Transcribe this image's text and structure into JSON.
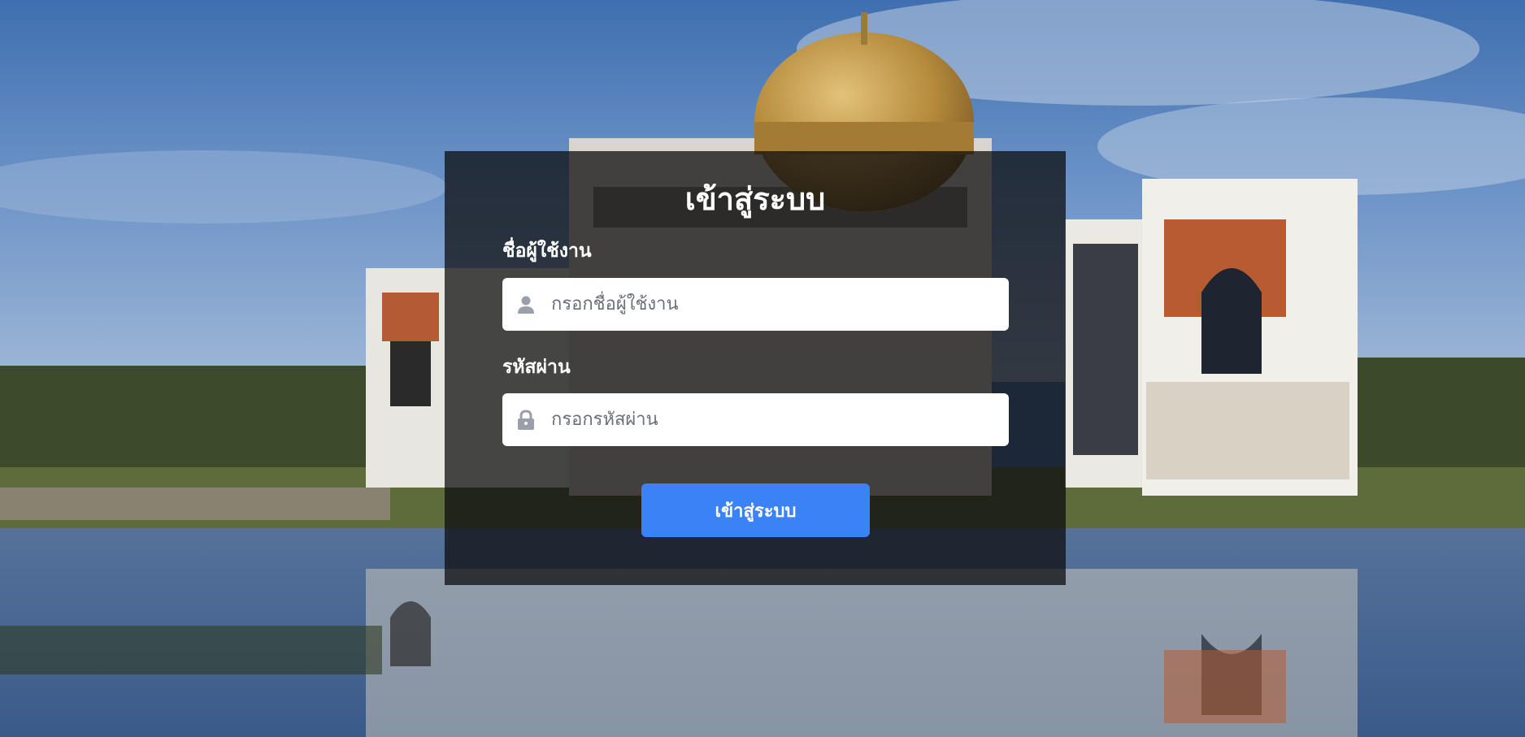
{
  "background": {
    "image": "mosque-with-golden-dome-reflected-in-pond"
  },
  "login": {
    "title": "เข้าสู่ระบบ",
    "username_label": "ชื่อผู้ใช้งาน",
    "username_placeholder": "กรอกชื่อผู้ใช้งาน",
    "username_value": "",
    "username_icon": "user-icon",
    "password_label": "รหัสผ่าน",
    "password_placeholder": "กรอกรหัสผ่าน",
    "password_value": "",
    "password_icon": "lock-icon",
    "submit_label": "เข้าสู่ระบบ"
  },
  "colors": {
    "button": "#3b82f6",
    "panel": "rgba(12,12,14,0.74)",
    "icon": "#9aa0aa"
  }
}
